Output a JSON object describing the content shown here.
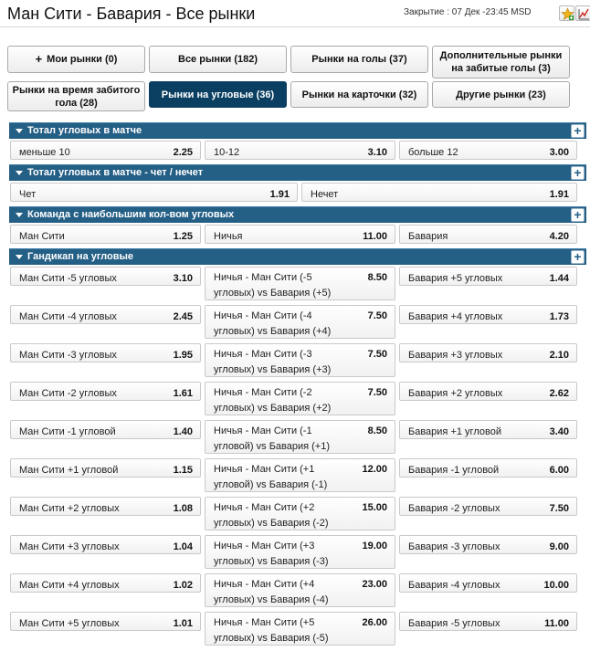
{
  "header": {
    "title": "Ман Сити - Бавария - Все рынки",
    "closing": "Закрытие : 07 Дек -23:45 MSD",
    "icons": [
      "star-plus-icon",
      "stats-chart-icon"
    ]
  },
  "tabs": [
    {
      "label": "Мои рынки (0)",
      "icon": "plus-icon",
      "active": false
    },
    {
      "label": "Все рынки (182)",
      "active": false
    },
    {
      "label": "Рынки на голы (37)",
      "active": false
    },
    {
      "label": "Дополнительные рынки на забитые голы (3)",
      "active": false
    },
    {
      "label": "Рынки на время забитого гола (28)",
      "active": false
    },
    {
      "label": "Рынки на угловые (36)",
      "active": true
    },
    {
      "label": "Рынки на карточки (32)",
      "active": false
    },
    {
      "label": "Другие рынки (23)",
      "active": false
    }
  ],
  "sections": [
    {
      "title": "Тотал угловых в матче",
      "rows": [
        [
          {
            "label": "меньше 10",
            "price": "2.25"
          },
          {
            "label": "10-12",
            "price": "3.10"
          },
          {
            "label": "больше 12",
            "price": "3.00"
          }
        ]
      ]
    },
    {
      "title": "Тотал угловых в матче - чет / нечет",
      "rows": [
        [
          {
            "label": "Чет",
            "price": "1.91"
          },
          {
            "label": "Нечет",
            "price": "1.91"
          }
        ]
      ]
    },
    {
      "title": "Команда с наибольшим кол-вом угловых",
      "rows": [
        [
          {
            "label": "Ман Сити",
            "price": "1.25"
          },
          {
            "label": "Ничья",
            "price": "11.00"
          },
          {
            "label": "Бавария",
            "price": "4.20"
          }
        ]
      ]
    },
    {
      "title": "Гандикап на угловые",
      "rows": [
        [
          {
            "label": "Ман Сити -5 угловых",
            "price": "3.10"
          },
          {
            "label": "Ничья - Ман Сити (-5 угловых) vs Бавария (+5)",
            "price": "8.50"
          },
          {
            "label": "Бавария +5 угловых",
            "price": "1.44"
          }
        ],
        [
          {
            "label": "Ман Сити -4 угловых",
            "price": "2.45"
          },
          {
            "label": "Ничья - Ман Сити (-4 угловых) vs Бавария (+4)",
            "price": "7.50"
          },
          {
            "label": "Бавария +4 угловых",
            "price": "1.73"
          }
        ],
        [
          {
            "label": "Ман Сити -3 угловых",
            "price": "1.95"
          },
          {
            "label": "Ничья - Ман Сити (-3 угловых) vs Бавария (+3)",
            "price": "7.50"
          },
          {
            "label": "Бавария +3 угловых",
            "price": "2.10"
          }
        ],
        [
          {
            "label": "Ман Сити -2 угловых",
            "price": "1.61"
          },
          {
            "label": "Ничья - Ман Сити (-2 угловых) vs Бавария (+2)",
            "price": "7.50"
          },
          {
            "label": "Бавария +2 угловых",
            "price": "2.62"
          }
        ],
        [
          {
            "label": "Ман Сити -1 угловой",
            "price": "1.40"
          },
          {
            "label": "Ничья - Ман Сити (-1 угловой) vs Бавария (+1)",
            "price": "8.50"
          },
          {
            "label": "Бавария +1 угловой",
            "price": "3.40"
          }
        ],
        [
          {
            "label": "Ман Сити +1 угловой",
            "price": "1.15"
          },
          {
            "label": "Ничья - Ман Сити (+1 угловой) vs Бавария (-1)",
            "price": "12.00"
          },
          {
            "label": "Бавария -1 угловой",
            "price": "6.00"
          }
        ],
        [
          {
            "label": "Ман Сити +2 угловых",
            "price": "1.08"
          },
          {
            "label": "Ничья - Ман Сити (+2 угловых) vs Бавария (-2)",
            "price": "15.00"
          },
          {
            "label": "Бавария -2 угловых",
            "price": "7.50"
          }
        ],
        [
          {
            "label": "Ман Сити +3 угловых",
            "price": "1.04"
          },
          {
            "label": "Ничья - Ман Сити (+3 угловых) vs Бавария (-3)",
            "price": "19.00"
          },
          {
            "label": "Бавария -3 угловых",
            "price": "9.00"
          }
        ],
        [
          {
            "label": "Ман Сити +4 угловых",
            "price": "1.02"
          },
          {
            "label": "Ничья - Ман Сити (+4 угловых) vs Бавария (-4)",
            "price": "23.00"
          },
          {
            "label": "Бавария -4 угловых",
            "price": "10.00"
          }
        ],
        [
          {
            "label": "Ман Сити +5 угловых",
            "price": "1.01"
          },
          {
            "label": "Ничья - Ман Сити (+5 угловых) vs Бавария (-5)",
            "price": "26.00"
          },
          {
            "label": "Бавария -5 угловых",
            "price": "11.00"
          }
        ]
      ]
    }
  ],
  "colors": {
    "header_bar": "#245f86",
    "active_tab": "#0a3f62"
  }
}
